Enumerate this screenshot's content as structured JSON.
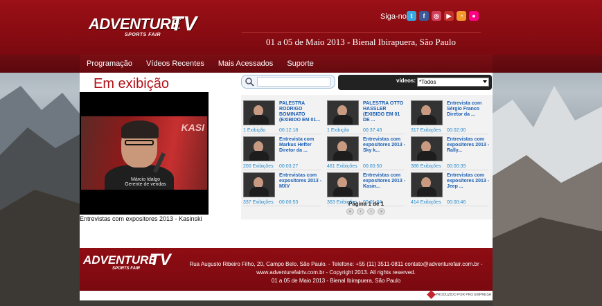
{
  "header": {
    "logo_word1": "ADVENTURE",
    "logo_word2": "TV",
    "logo_tagline": "SPORTS FAIR",
    "follow_label": "Siga-nos:",
    "event_date": "01 a 05 de Maio 2013 - Bienal Ibirapuera, São Paulo",
    "social_icons": [
      {
        "name": "twitter-icon",
        "color": "#3aa6e0",
        "glyph": "t"
      },
      {
        "name": "facebook-icon",
        "color": "#3b5998",
        "glyph": "f"
      },
      {
        "name": "instagram-icon",
        "color": "#d1405b",
        "glyph": "◎"
      },
      {
        "name": "youtube-icon",
        "color": "#c4302b",
        "glyph": "▶"
      },
      {
        "name": "rss-icon",
        "color": "#f29a2e",
        "glyph": "◔"
      },
      {
        "name": "flickr-icon",
        "color": "#ff0084",
        "glyph": "●"
      }
    ]
  },
  "nav": {
    "items": [
      "Programação",
      "Vídeos Recentes",
      "Mais Acessados",
      "Suporte"
    ]
  },
  "player": {
    "heading": "Em exibição",
    "brand": "KASI",
    "lower_name": "Márcio Idalgo",
    "lower_role": "Gerente de vendas",
    "caption": "Entrevistas com expositores 2013 - Kasinski"
  },
  "search": {
    "placeholder": ""
  },
  "filter": {
    "label": "vídeos:",
    "selected": "*Todos"
  },
  "videos": [
    {
      "title": "PALESTRA RODRIGO BOMINATO (EXIBIDO EM 01...",
      "views": "1 Exibição",
      "duration": "00:12:18"
    },
    {
      "title": "PALESTRA OTTO HASSLER (EXIBIDO EM 01 DE ...",
      "views": "1 Exibição",
      "duration": "00:37:43"
    },
    {
      "title": "Entrevista com Sérgio Franco Diretor da ...",
      "views": "317 Exibições",
      "duration": "00:02:00"
    },
    {
      "title": "Entrevista com Markus Hefter Diretor da ...",
      "views": "200 Exibições",
      "duration": "00:03:27"
    },
    {
      "title": "Entrevistas com expositores 2013 - Sky k...",
      "views": "461 Exibições",
      "duration": "00:00:50"
    },
    {
      "title": "Entrevistas com expositores 2013 - Rally...",
      "views": "386 Exibições",
      "duration": "00:00:39"
    },
    {
      "title": "Entrevistas com expositores 2013 - MXV",
      "views": "337 Exibições",
      "duration": "00:00:53"
    },
    {
      "title": "Entrevistas com expositores 2013 - Kasin...",
      "views": "363 Exibições",
      "duration": "00:01:04"
    },
    {
      "title": "Entrevistas com expositores 2013 - Jeep ...",
      "views": "414 Exibições",
      "duration": "00:00:46"
    }
  ],
  "pagination": {
    "label": "Página 1 de 1",
    "buttons": [
      "«",
      "‹",
      "›",
      "»"
    ]
  },
  "footer": {
    "logo_word1": "ADVENTURE",
    "logo_word2": "TV",
    "logo_tagline": "SPORTS FAIR",
    "address_line": "Rua Augusto Ribeiro Filho, 20, Campo Belo. São Paulo. - Telefone: +55 (11) 3511-0811 contato@adventurefair.com.br -",
    "site_line": "www.adventurefairtv.com.br - Copyright 2013. All rights reserved.",
    "event_line": "01 a 05 de Maio 2013 - Bienal Ibirapuera, São Paulo",
    "credit": "PRODUZIDO POR PRO EMPRESA"
  },
  "colors": {
    "header_red": "#8a0c12",
    "nav_dark_red": "#5b080d",
    "heading_red": "#b11119",
    "link_blue": "#1a5fb4"
  }
}
